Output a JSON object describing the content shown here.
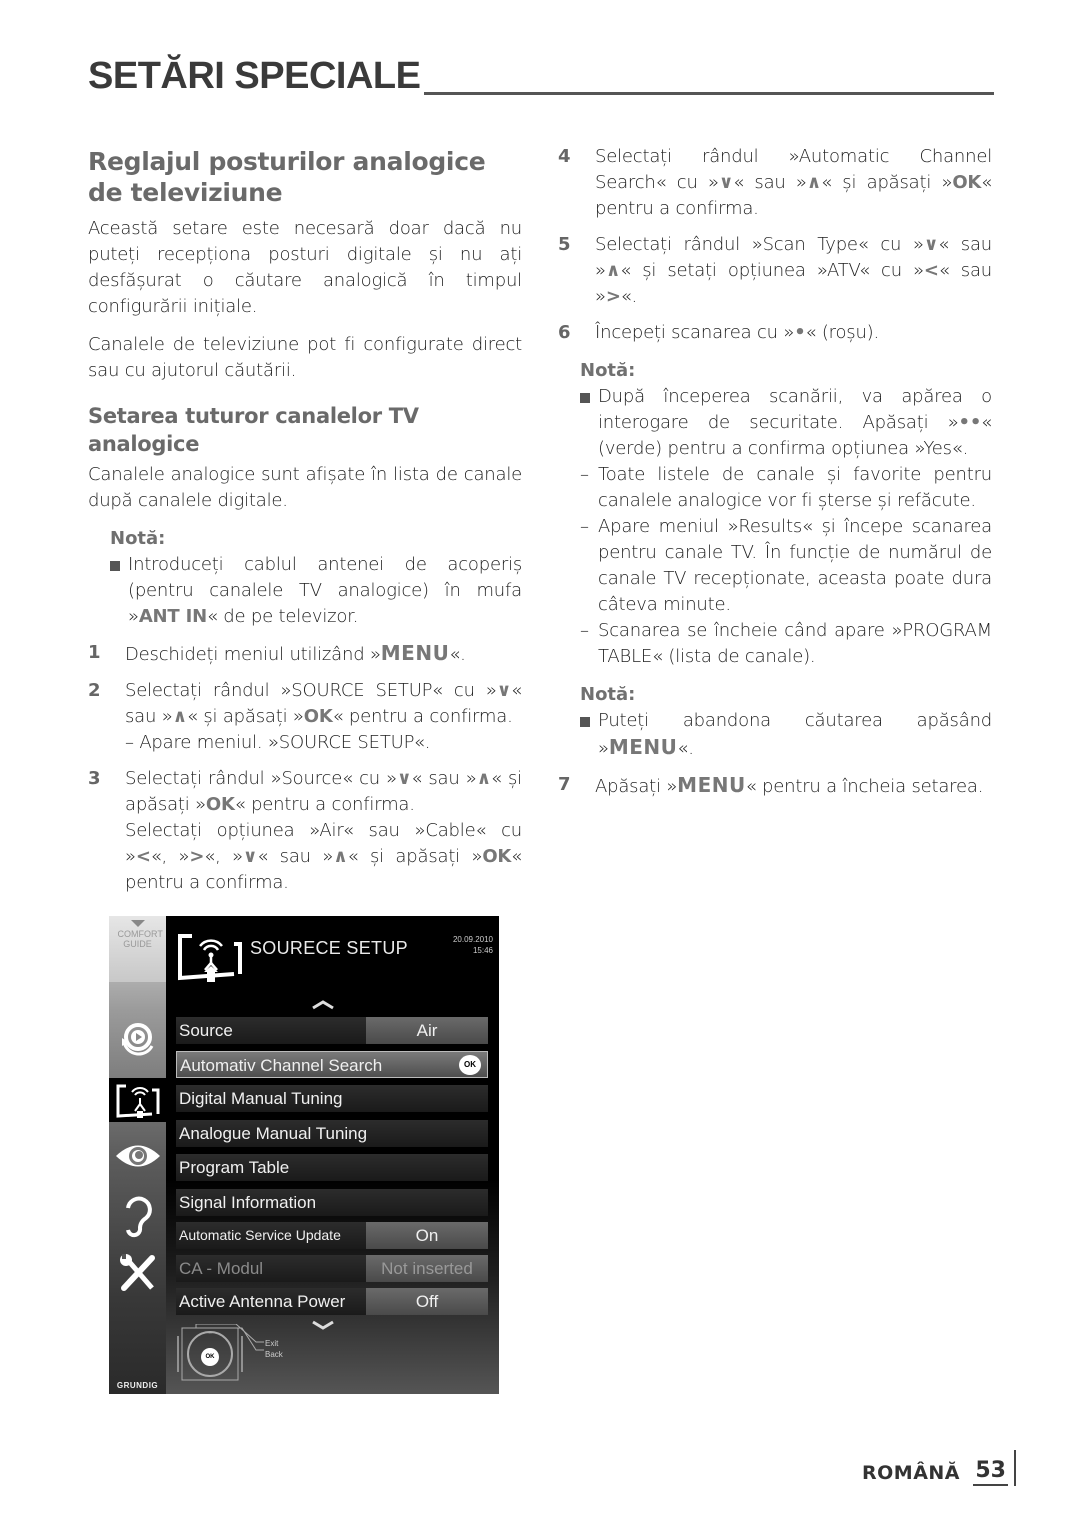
{
  "header": {
    "title": "SETĂRI SPECIALE"
  },
  "left": {
    "heading": "Reglajul posturilor analogice de televiziune",
    "intro_1": "Această setare este necesară doar dacă nu puteți recepționa posturi digitale și nu ați desfășurat o căutare analogică în timpul configurării inițiale.",
    "intro_2": "Canalele de televiziune pot fi configurate direct sau cu ajutorul căutării.",
    "subheading": "Setarea tuturor canalelor TV analogice",
    "sub_text": "Canalele analogice sunt afișate în lista de canale după canalele digitale.",
    "note_label": "Notă:",
    "note_text_a": "Introduceți cablul antenei de acoperiș (pentru canalele TV analogice) în mufa »",
    "note_key": "ANT IN",
    "note_text_b": "« de pe televizor.",
    "steps": [
      {
        "num": "1",
        "a": "Deschideți meniul utilizând »",
        "k1": "MENU",
        "b": "«."
      },
      {
        "num": "2",
        "a": "Selectați rândul »SOURCE SETUP« cu »",
        "k1": "∨",
        "b": "« sau »",
        "k2": "∧",
        "c": "« și apăsați »",
        "k3": "OK",
        "d": "« pentru a confirma.",
        "sub": "– Apare meniul. »SOURCE SETUP«."
      },
      {
        "num": "3",
        "a": "Selectați rândul »Source« cu »",
        "k1": "∨",
        "b": "« sau »",
        "k2": "∧",
        "c": "« și apăsați »",
        "k3": "OK",
        "d": "« pentru a confirma.",
        "e": "Selectați opțiunea »Air« sau »Cable« cu »",
        "k4": "<",
        "f": "«, »",
        "k5": ">",
        "g": "«, »",
        "k6": "∨",
        "h": "« sau »",
        "k7": "∧",
        "i": "« și apăsați »",
        "k8": "OK",
        "j": "« pentru a confirma."
      }
    ]
  },
  "right": {
    "steps": [
      {
        "num": "4",
        "a": "Selectați rândul »Automatic Channel Search« cu »",
        "k1": "∨",
        "b": "« sau »",
        "k2": "∧",
        "c": "« și apăsați »",
        "k3": "OK",
        "d": "« pentru a confirma."
      },
      {
        "num": "5",
        "a": "Selectați rândul »Scan Type« cu »",
        "k1": "∨",
        "b": "« sau »",
        "k2": "∧",
        "c": "« și setați opțiunea »ATV« cu »",
        "k3": "<",
        "d": "« sau »",
        "k4": ">",
        "e": "«."
      },
      {
        "num": "6",
        "a": "Începeți scanarea cu »",
        "k1": "•",
        "b": "« (roșu)."
      }
    ],
    "note1_label": "Notă:",
    "note1_bullet_a": "După începerea scanării, va apărea o interogare de securitate. Apăsați »",
    "note1_key": "••",
    "note1_bullet_b": "« (verde) pentru a confirma opțiunea »Yes«.",
    "note1_dashes": [
      "Toate listele de canale și favorite pentru canalele analogice vor fi șterse și refăcute.",
      "Apare meniul »Results« și începe scanarea pentru canale TV. În funcție de numărul de canale TV recepționate, aceasta poate dura câteva minute.",
      "Scanarea se încheie când apare »PROGRAM TABLE« (lista de canale)."
    ],
    "note2_label": "Notă:",
    "note2_a": "Puteți abandona căutarea apăsând »",
    "note2_key": "MENU",
    "note2_b": "«.",
    "step7": {
      "num": "7",
      "a": "Apăsați »",
      "k1": "MENU",
      "b": "« pentru a încheia setarea."
    }
  },
  "osd": {
    "comfort_guide": "COMFORT GUIDE",
    "title": "SOURECE SETUP",
    "date": "20.09.2010",
    "time": "15:46",
    "brand": "GRUNDIG",
    "rows": [
      {
        "label": "Source",
        "value": "Air"
      },
      {
        "label": "Automativ Channel Search",
        "badge": "OK"
      },
      {
        "label": "Digital Manual Tuning"
      },
      {
        "label": "Analogue Manual Tuning"
      },
      {
        "label": "Program Table"
      },
      {
        "label": "Signal Information"
      },
      {
        "label": "Automatic Service Update",
        "value": "On"
      },
      {
        "label": "CA - Modul",
        "value": "Not inserted"
      },
      {
        "label": "Active Antenna Power",
        "value": "Off"
      }
    ],
    "remote_exit": "Exit",
    "remote_back": "Back",
    "remote_ok": "OK"
  },
  "footer": {
    "language": "ROMÂNĂ",
    "page": "53"
  }
}
